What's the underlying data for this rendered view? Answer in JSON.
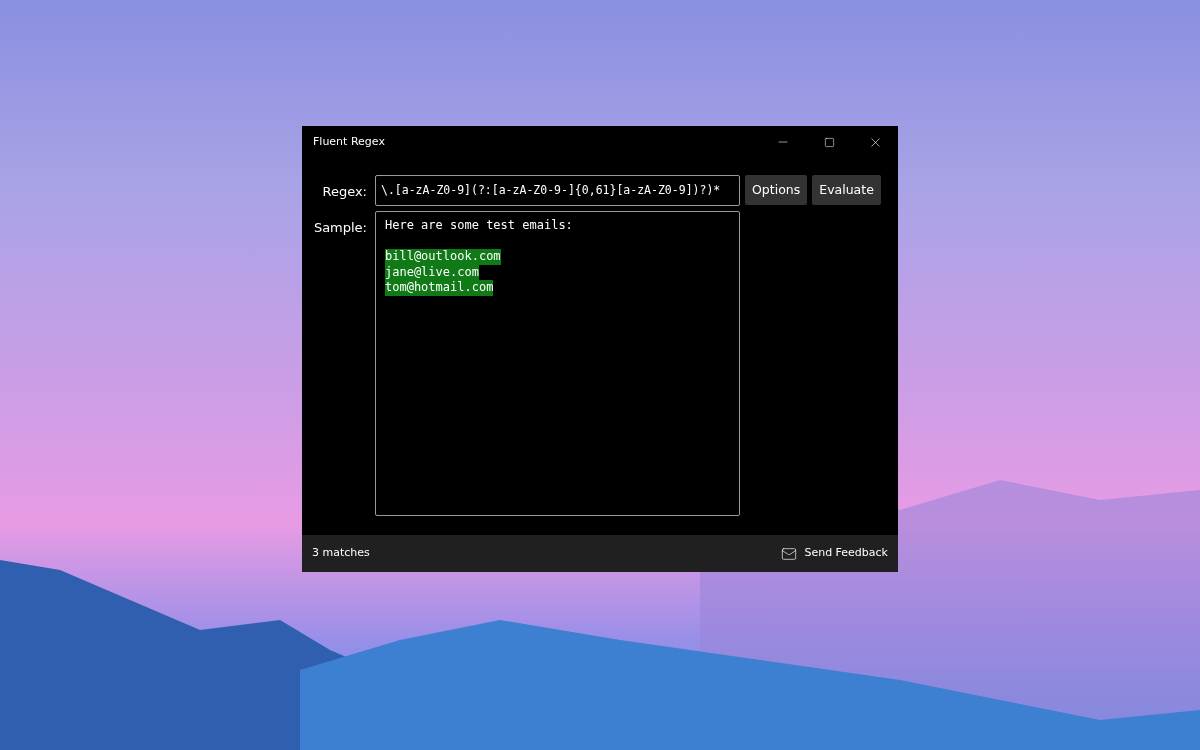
{
  "window": {
    "title": "Fluent Regex"
  },
  "regex": {
    "label": "Regex:",
    "value": "\\.[a-zA-Z0-9](?:[a-zA-Z0-9-]{0,61}[a-zA-Z0-9])?)*"
  },
  "buttons": [
    "Options",
    "Evaluate"
  ],
  "sample": {
    "label": "Sample:",
    "lines": [
      {
        "text": "Here are some test emails:",
        "matched": false,
        "blank_line_before": false
      },
      {
        "text": "bill@outlook.com",
        "matched": true,
        "blank_line_before": true
      },
      {
        "text": "jane@live.com",
        "matched": true,
        "blank_line_before": false
      },
      {
        "text": "tom@hotmail.com",
        "matched": true,
        "blank_line_before": false
      }
    ]
  },
  "status_bar": {
    "matches": "3 matches",
    "feedback": "Send Feedback"
  }
}
